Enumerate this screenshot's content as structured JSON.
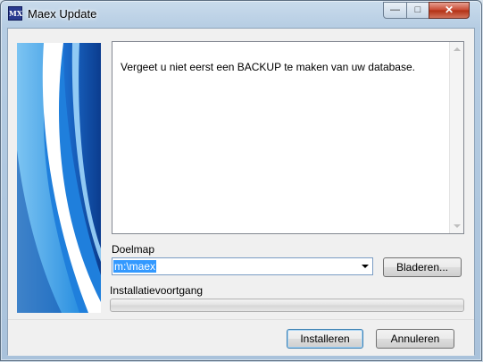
{
  "window": {
    "title": "Maex Update",
    "icon": "maex-app-icon",
    "icon_text": "MX",
    "controls": {
      "minimize": "minimize-icon",
      "maximize": "maximize-icon",
      "close": "close-icon"
    }
  },
  "banner": {
    "image": "blue-swoosh-banner"
  },
  "memo": {
    "text": "Vergeet u niet eerst een BACKUP te maken van uw database."
  },
  "target_folder": {
    "label": "Doelmap",
    "value": "m:\\maex",
    "browse_label": "Bladeren..."
  },
  "progress": {
    "label": "Installatievoortgang",
    "value": 0
  },
  "buttons": {
    "install": "Installeren",
    "cancel": "Annuleren"
  },
  "colors": {
    "selection": "#3399ff",
    "titlebar": "#b6cde3",
    "close_button": "#c7462f"
  }
}
